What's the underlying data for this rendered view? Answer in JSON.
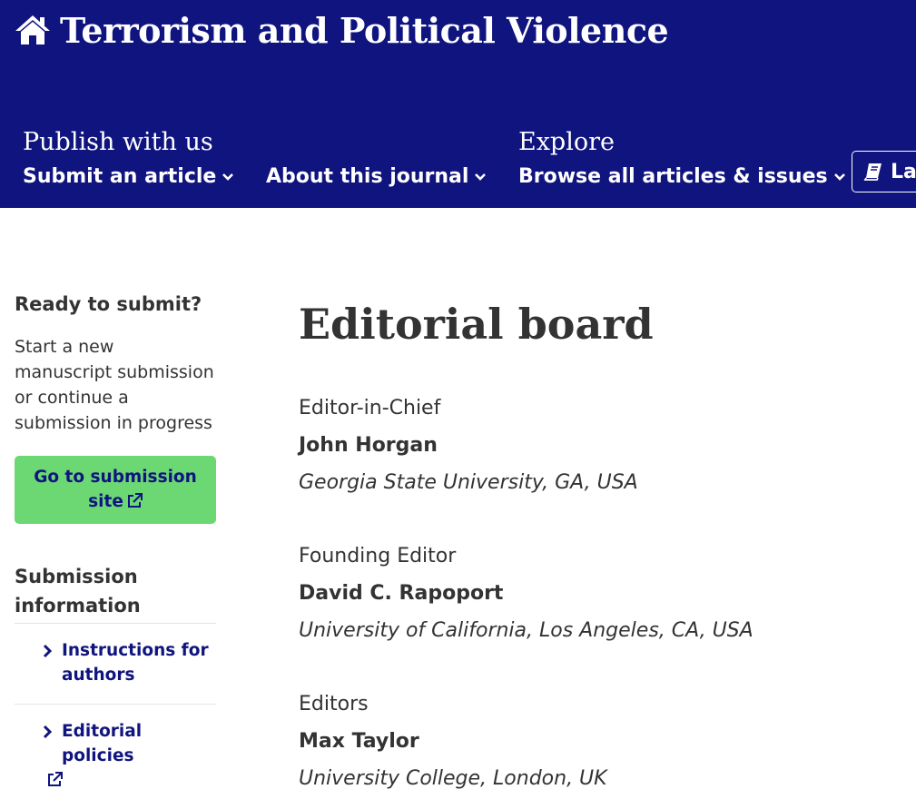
{
  "header": {
    "journal_title": "Terrorism and Political Violence",
    "groups": [
      {
        "label": "Publish with us"
      },
      {
        "label": "Explore"
      }
    ],
    "nav": [
      {
        "label": "Submit an article"
      },
      {
        "label": "About this journal"
      },
      {
        "label": "Browse all articles & issues"
      }
    ],
    "latest_label": "La",
    "colors": {
      "background": "#10147e",
      "text": "#ffffff"
    }
  },
  "sidebar": {
    "ready_heading": "Ready to submit?",
    "ready_text": "Start a new manuscript submission or continue a submission in progress",
    "submit_button": "Go to submission site",
    "submit_button_color": "#6bd873",
    "submission_info_heading": "Submission information",
    "links": [
      {
        "label": "Instructions for authors"
      },
      {
        "label": "Editorial policies"
      }
    ]
  },
  "main": {
    "title": "Editorial board",
    "sections": [
      {
        "role": "Editor-in-Chief",
        "name": "John Horgan",
        "affiliation": "Georgia State University, GA, USA"
      },
      {
        "role": "Founding Editor",
        "name": "David C. Rapoport",
        "affiliation": "University of California, Los Angeles, CA, USA"
      },
      {
        "role": "Editors",
        "name": "Max Taylor",
        "affiliation": "University College, London, UK"
      }
    ]
  },
  "icons": [
    "home-icon",
    "chevron-down-icon",
    "book-icon",
    "external-link-icon",
    "chevron-right-icon"
  ]
}
